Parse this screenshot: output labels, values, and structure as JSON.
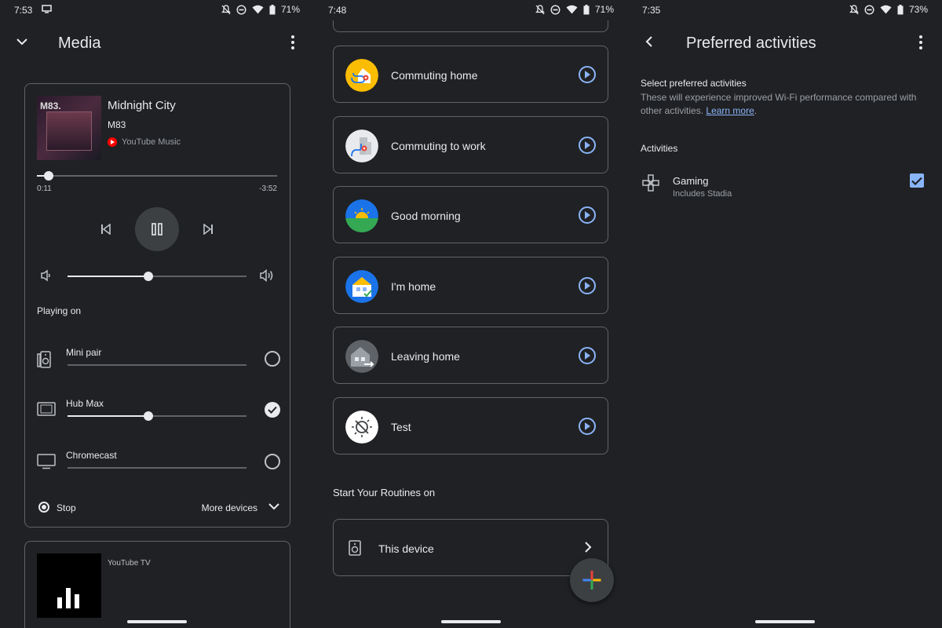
{
  "media_panel": {
    "status": {
      "time": "7:53",
      "battery": "71%"
    },
    "title": "Media",
    "now_playing": {
      "album_text": "M83.",
      "song": "Midnight City",
      "artist": "M83",
      "source": "YouTube Music",
      "elapsed": "0:11",
      "remaining": "-3:52",
      "progress_fraction": 0.05,
      "volume_fraction": 0.45
    },
    "playing_on_label": "Playing on",
    "devices": [
      {
        "name": "Mini pair",
        "selected": false,
        "volume_fraction": 0
      },
      {
        "name": "Hub Max",
        "selected": true,
        "volume_fraction": 0.45
      },
      {
        "name": "Chromecast",
        "selected": false,
        "volume_fraction": 0
      }
    ],
    "stop_label": "Stop",
    "more_devices_label": "More devices",
    "second_card": {
      "source": "YouTube TV"
    }
  },
  "routines_panel": {
    "status": {
      "time": "7:48",
      "battery": "71%"
    },
    "routines": [
      {
        "label": "Commuting home",
        "icon": "commute-home-icon"
      },
      {
        "label": "Commuting to work",
        "icon": "commute-work-icon"
      },
      {
        "label": "Good morning",
        "icon": "sunrise-icon"
      },
      {
        "label": "I'm home",
        "icon": "house-check-icon"
      },
      {
        "label": "Leaving home",
        "icon": "house-leave-icon"
      },
      {
        "label": "Test",
        "icon": "custom-routine-icon"
      }
    ],
    "section_heading": "Start Your Routines on",
    "this_device_label": "This device"
  },
  "activities_panel": {
    "status": {
      "time": "7:35",
      "battery": "73%"
    },
    "title": "Preferred activities",
    "select_heading": "Select preferred activities",
    "select_desc": "These will experience improved Wi-Fi performance compared with other activities.",
    "learn_more": "Learn more",
    "activities_heading": "Activities",
    "gaming": {
      "name": "Gaming",
      "subtitle": "Includes Stadia",
      "checked": true
    }
  },
  "colors": {
    "background": "#202124",
    "accent": "#8ab4f8",
    "border": "#5f6368"
  }
}
